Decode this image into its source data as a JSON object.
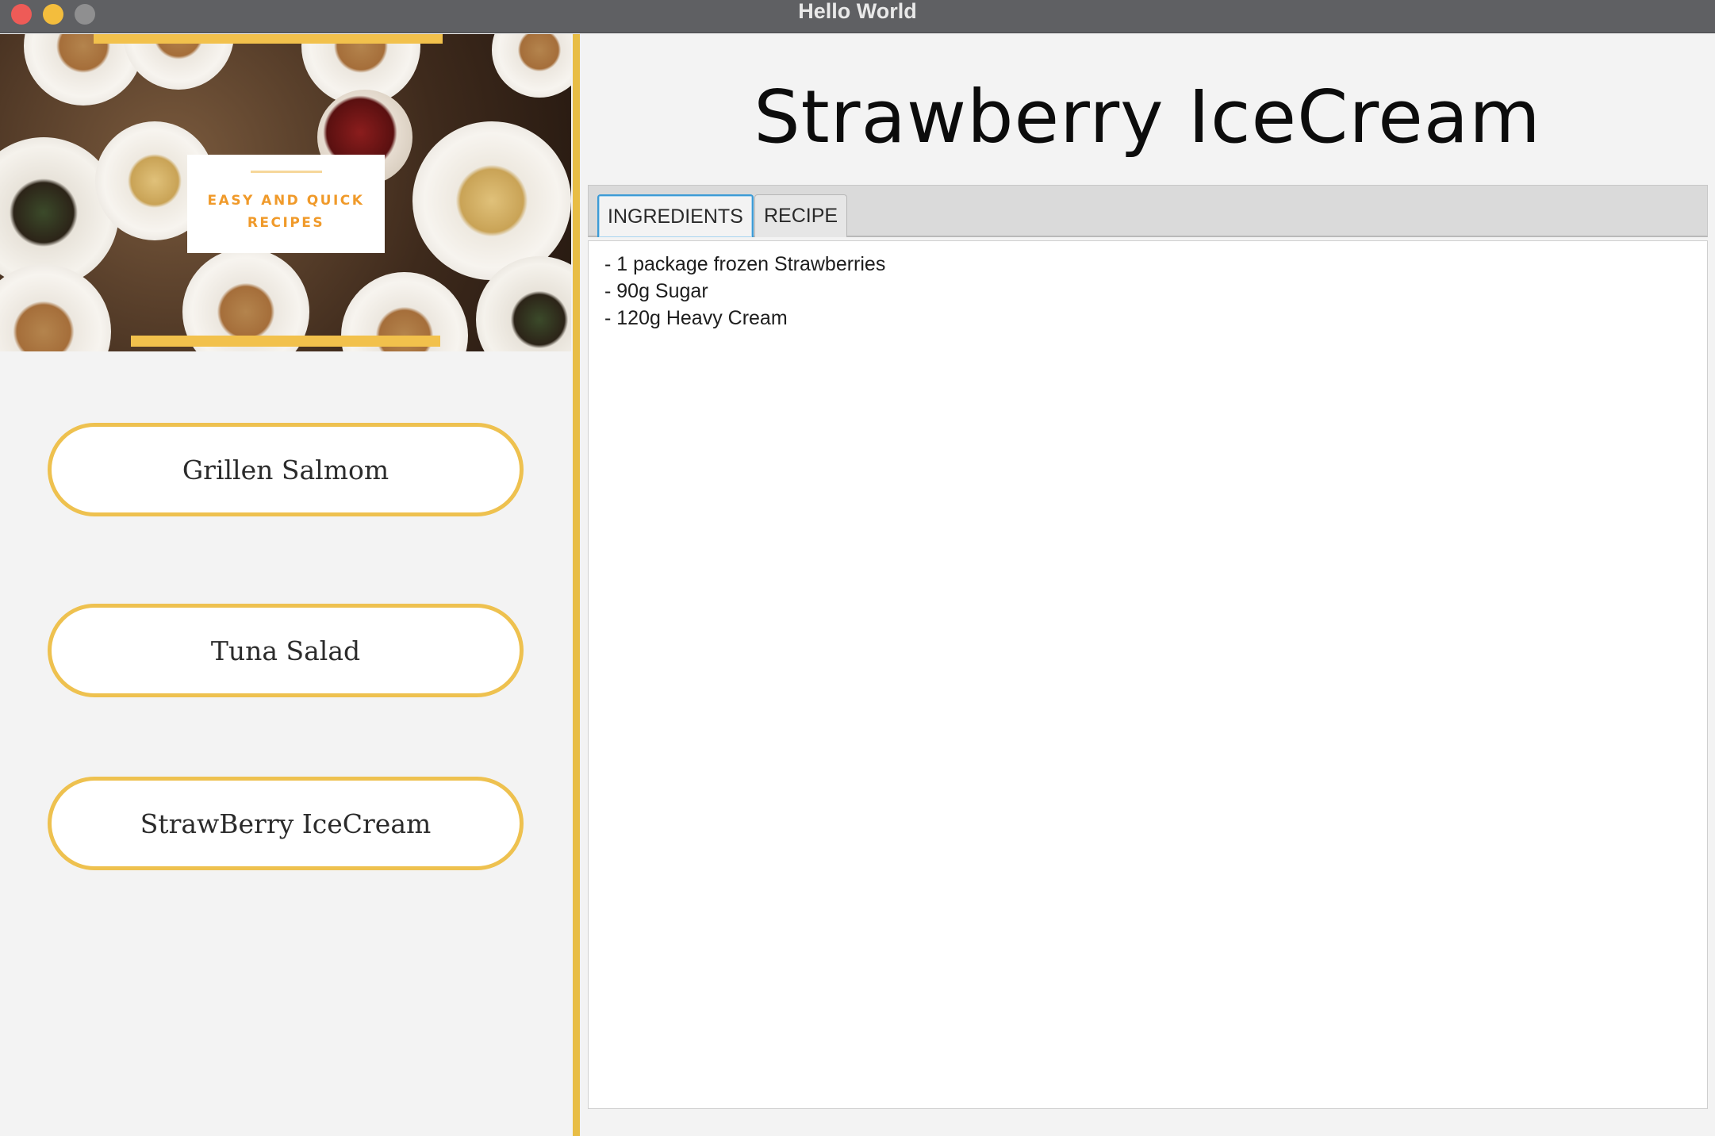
{
  "window": {
    "title": "Hello World"
  },
  "banner": {
    "line1": "EASY AND QUICK",
    "line2": "RECIPES"
  },
  "recipe_buttons": [
    {
      "label": "Grillen Salmom"
    },
    {
      "label": "Tuna Salad"
    },
    {
      "label": "StrawBerry IceCream"
    }
  ],
  "main": {
    "title": "Strawberry IceCream",
    "tabs": [
      {
        "label": "INGREDIENTS",
        "active": true
      },
      {
        "label": "RECIPE",
        "active": false
      }
    ],
    "ingredients": [
      "- 1 package frozen Strawberries",
      "- 90g Sugar",
      "- 120g Heavy Cream"
    ]
  },
  "colors": {
    "accent_yellow": "#eec14f",
    "tab_focus_blue": "#3c9bd6",
    "titlebar": "#5f6063"
  }
}
